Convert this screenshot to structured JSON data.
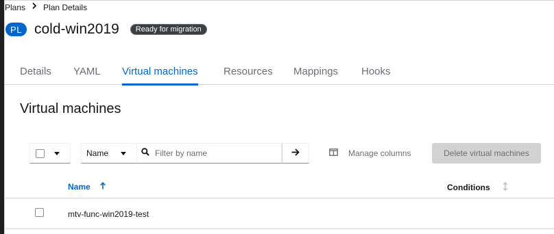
{
  "breadcrumb": {
    "items": [
      "Plans",
      "Plan Details"
    ],
    "separator_icon": "chevron-right-icon"
  },
  "header": {
    "avatar_label": "PL",
    "title": "cold-win2019",
    "status": "Ready for migration"
  },
  "tabs": [
    {
      "label": "Details",
      "active": false
    },
    {
      "label": "YAML",
      "active": false
    },
    {
      "label": "Virtual machines",
      "active": true
    },
    {
      "label": "Resources",
      "active": false
    },
    {
      "label": "Mappings",
      "active": false
    },
    {
      "label": "Hooks",
      "active": false
    }
  ],
  "section": {
    "title": "Virtual machines"
  },
  "toolbar": {
    "filter_type": "Name",
    "filter_placeholder": "Filter by name",
    "manage_columns_label": "Manage columns",
    "delete_label": "Delete virtual machines"
  },
  "table": {
    "columns": [
      {
        "label": "Name",
        "sorted": true
      },
      {
        "label": "Conditions",
        "sorted": false
      }
    ],
    "rows": [
      {
        "name": "mtv-func-win2019-test",
        "conditions": ""
      }
    ]
  },
  "colors": {
    "accent": "#0066cc",
    "status_pill": "#3c3f42",
    "disabled_button": "#d2d2d2"
  }
}
